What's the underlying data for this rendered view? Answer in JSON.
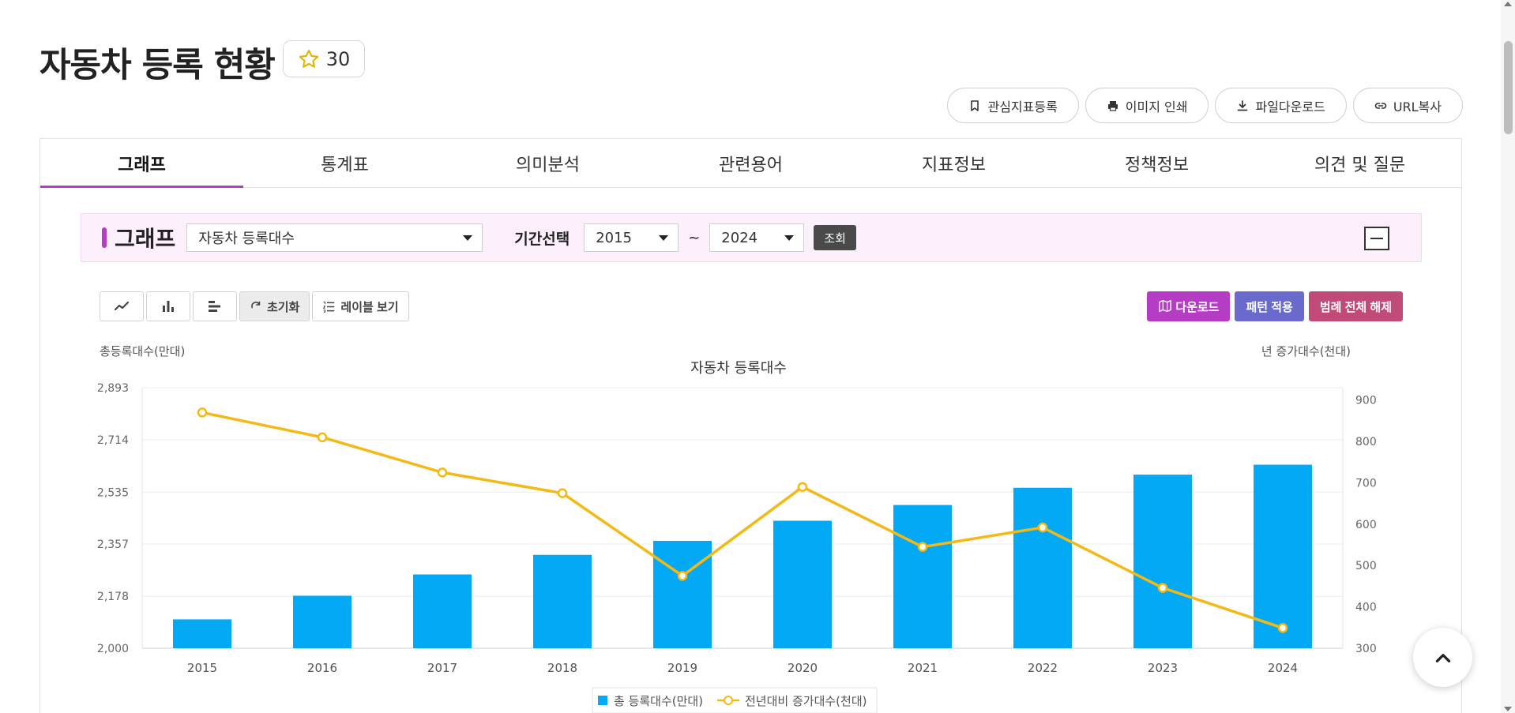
{
  "page": {
    "title": "자동차 등록 현황",
    "favorite_count": "30"
  },
  "actions": {
    "bookmark": "관심지표등록",
    "print": "이미지 인쇄",
    "download": "파일다운로드",
    "url_copy": "URL복사"
  },
  "tabs": [
    {
      "label": "그래프"
    },
    {
      "label": "통계표"
    },
    {
      "label": "의미분석"
    },
    {
      "label": "관련용어"
    },
    {
      "label": "지표정보"
    },
    {
      "label": "정책정보"
    },
    {
      "label": "의견 및 질문"
    }
  ],
  "filter": {
    "label": "그래프",
    "indicator": "자동차 등록대수",
    "period_label": "기간선택",
    "start_year": "2015",
    "tilde": "~",
    "end_year": "2024",
    "query_label": "조회"
  },
  "toolbar": {
    "reset_label": "초기화",
    "label_view": "레이블 보기",
    "download": "다운로드",
    "pattern": "패턴 적용",
    "legend_clear": "범례 전체 해제"
  },
  "colors": {
    "accent": "#b53cc4",
    "bar": "#03a9f4",
    "line": "#f4b914"
  },
  "chart_data": {
    "type": "bar",
    "title": "자동차 등록대수",
    "ylabel": "총등록대수(만대)",
    "ylabel_right": "년 증가대수(천대)",
    "categories": [
      "2015",
      "2016",
      "2017",
      "2018",
      "2019",
      "2020",
      "2021",
      "2022",
      "2023",
      "2024"
    ],
    "ylim": [
      2000,
      2893
    ],
    "yticks": [
      "2,000",
      "2,178",
      "2,357",
      "2,535",
      "2,714",
      "2,893"
    ],
    "y2lim": [
      300,
      930
    ],
    "y2ticks": [
      "300",
      "400",
      "500",
      "600",
      "700",
      "800",
      "900"
    ],
    "grid": true,
    "legend_position": "bottom",
    "series": [
      {
        "name": "총 등록대수(만대)",
        "type": "bar",
        "axis": "left",
        "values": [
          2099,
          2180,
          2253,
          2320,
          2368,
          2437,
          2491,
          2550,
          2595,
          2629
        ]
      },
      {
        "name": "전년대비 증가대수(천대)",
        "type": "line",
        "axis": "right",
        "values": [
          870,
          810,
          725,
          675,
          475,
          690,
          545,
          592,
          446,
          349
        ]
      }
    ]
  }
}
